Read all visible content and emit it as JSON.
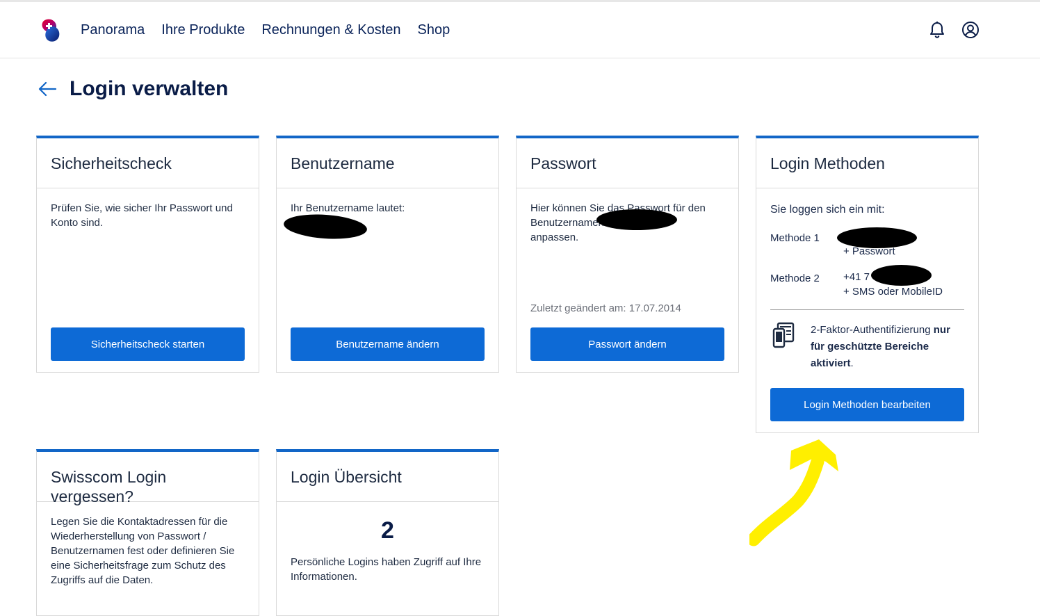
{
  "header": {
    "nav": [
      "Panorama",
      "Ihre Produkte",
      "Rechnungen & Kosten",
      "Shop"
    ],
    "icons": {
      "logo": "swisscom-logo-icon",
      "notifications": "bell-icon",
      "account": "user-circle-icon"
    }
  },
  "page": {
    "title": "Login verwalten",
    "back_icon": "arrow-left-icon"
  },
  "colors": {
    "accent": "#1266c7",
    "button": "#0d6ad6",
    "title": "#0a1c47",
    "annotation": "#ffef00"
  },
  "cards": {
    "security": {
      "title": "Sicherheitscheck",
      "text": "Prüfen Sie, wie sicher Ihr Passwort und Konto sind.",
      "button": "Sicherheitscheck starten"
    },
    "username": {
      "title": "Benutzername",
      "text": "Ihr Benutzername lautet:",
      "button": "Benutzername ändern"
    },
    "password": {
      "title": "Passwort",
      "text_line1": "Hier können Sie das Passwort für den",
      "text_line2": "Benutzernamen",
      "text_line3": "anpassen.",
      "changed": "Zuletzt geändert am: 17.07.2014",
      "button": "Passwort ändern"
    },
    "methods": {
      "title": "Login Methoden",
      "intro": "Sie loggen sich ein mit:",
      "method1_label": "Methode 1",
      "method1_detail": "+ Passwort",
      "method2_label": "Methode 2",
      "method2_phone": "+41 7",
      "method2_detail": "+ SMS oder MobileID",
      "twofactor_prefix": "2-Faktor-Authentifizierung ",
      "twofactor_bold": "nur für geschützte Bereiche aktiviert",
      "twofactor_suffix": ".",
      "twofactor_icon": "devices-icon",
      "button": "Login Methoden bearbeiten"
    },
    "forgot": {
      "title": "Swisscom Login vergessen?",
      "text": "Legen Sie die Kontaktadressen für die Wiederherstellung von Passwort / Benutzernamen fest oder definieren Sie eine Sicherheitsfrage zum Schutz des Zugriffs auf die Daten."
    },
    "overview": {
      "title": "Login Übersicht",
      "count": "2",
      "text": "Persönliche Logins haben Zugriff auf Ihre Informationen."
    }
  }
}
